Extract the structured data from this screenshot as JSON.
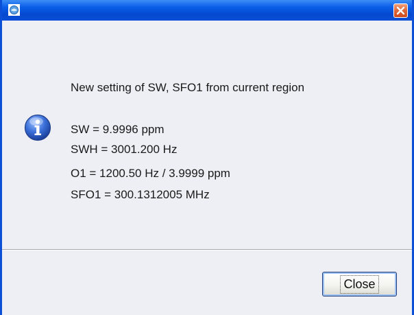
{
  "window": {
    "icons": {
      "app": "java-cup-icon",
      "close": "close-icon",
      "message": "info-icon"
    },
    "accent_color": "#0a4fd6"
  },
  "message": {
    "heading": "New setting of SW, SFO1 from current region",
    "lines": [
      "SW = 9.9996 ppm",
      "SWH = 3001.200 Hz",
      "O1 = 1200.50 Hz / 3.9999 ppm",
      "SFO1 = 300.1312005 MHz"
    ]
  },
  "footer": {
    "close_label": "Close"
  }
}
